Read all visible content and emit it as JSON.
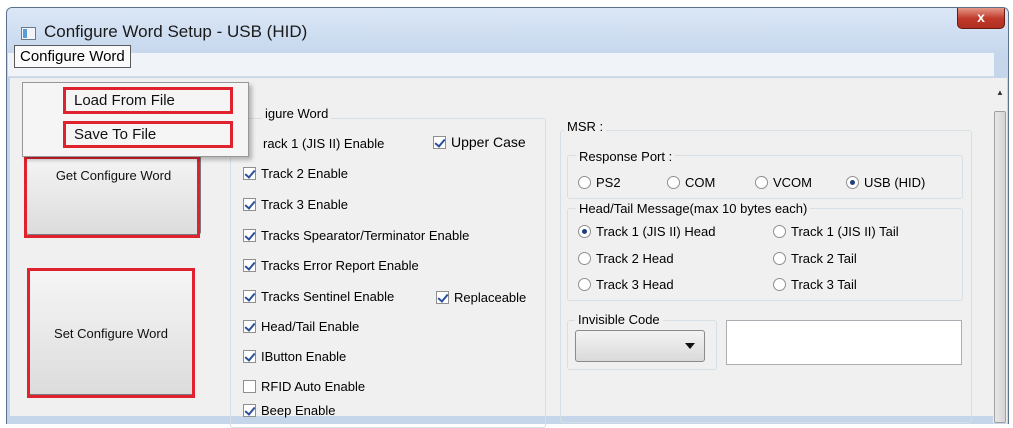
{
  "window": {
    "title": "Configure Word Setup - USB (HID)",
    "close_glyph": "x"
  },
  "menubar": {
    "menu_label": "Configure Word"
  },
  "dropdown": {
    "items": [
      "Load From File",
      "Save To File"
    ]
  },
  "buttons": {
    "get_label": "Get Configure Word",
    "set_label": "Set Configure Word"
  },
  "config_group": {
    "label_visible": "igure Word",
    "checkboxes": [
      {
        "label": "rack 1 (JIS II) Enable",
        "checked": true
      },
      {
        "label": "Upper Case",
        "checked": true
      },
      {
        "label": "Track 2 Enable",
        "checked": true
      },
      {
        "label": "Track 3 Enable",
        "checked": true
      },
      {
        "label": "Tracks Spearator/Terminator Enable",
        "checked": true
      },
      {
        "label": "Tracks Error Report Enable",
        "checked": true
      },
      {
        "label": "Tracks Sentinel Enable",
        "checked": true
      },
      {
        "label": "Replaceable",
        "checked": true
      },
      {
        "label": "Head/Tail Enable",
        "checked": true
      },
      {
        "label": "IButton Enable",
        "checked": true
      },
      {
        "label": "RFID Auto Enable",
        "checked": false
      },
      {
        "label": "Beep Enable",
        "checked": true
      }
    ]
  },
  "msr": {
    "label": "MSR :",
    "response_port": {
      "label": "Response Port :",
      "options": [
        "PS2",
        "COM",
        "VCOM",
        "USB (HID)"
      ],
      "selected": "USB (HID)"
    },
    "head_tail": {
      "label": "Head/Tail Message(max 10 bytes each)",
      "options": [
        "Track 1 (JIS II) Head",
        "Track 1 (JIS II) Tail",
        "Track 2 Head",
        "Track 2 Tail",
        "Track 3 Head",
        "Track 3 Tail"
      ],
      "selected": "Track 1 (JIS II) Head"
    },
    "invisible_code": {
      "label": "Invisible Code",
      "value": ""
    }
  },
  "colors": {
    "highlight": "#e0222e",
    "check": "#2b4f9a",
    "titlebar": "#c3d5ec"
  }
}
